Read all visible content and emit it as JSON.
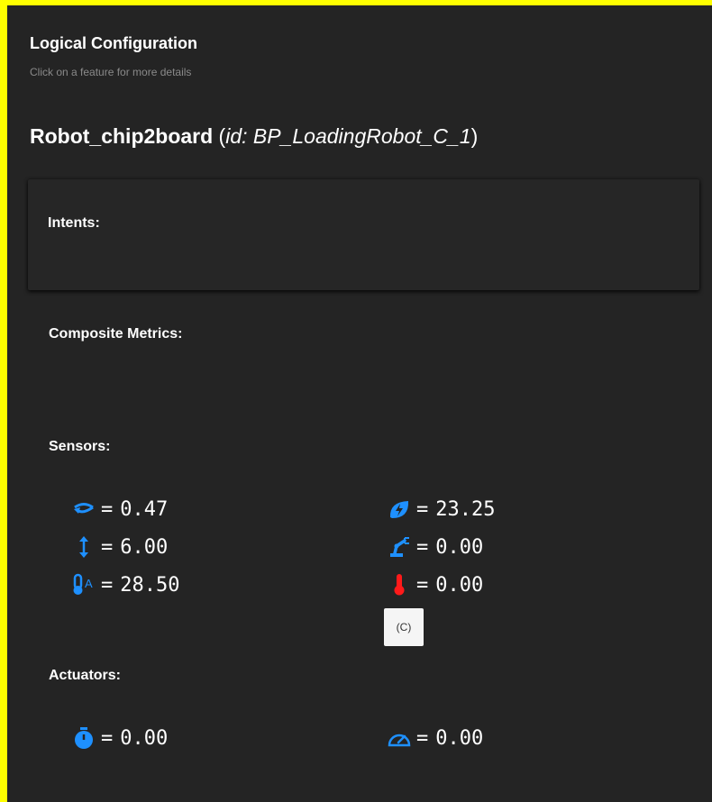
{
  "header": {
    "title": "Logical Configuration",
    "subtitle": "Click on a feature for more details"
  },
  "robot": {
    "name": "Robot_chip2board",
    "id_open": " (",
    "id_label": "id: BP_LoadingRobot_C_1",
    "id_close": ")"
  },
  "sections": {
    "intents": "Intents:",
    "composite_metrics": "Composite Metrics:",
    "sensors": "Sensors:",
    "actuators": "Actuators:"
  },
  "sensors": [
    {
      "icon": "rotation-icon",
      "eq": "=",
      "value": "0.47"
    },
    {
      "icon": "energy-leaf-icon",
      "eq": "=",
      "value": "23.25"
    },
    {
      "icon": "vertical-arrows-icon",
      "eq": "=",
      "value": "6.00"
    },
    {
      "icon": "robot-arm-icon",
      "eq": "=",
      "value": "0.00"
    },
    {
      "icon": "ambient-thermometer-icon",
      "eq": "=",
      "value": "28.50"
    },
    {
      "icon": "thermometer-icon",
      "eq": "=",
      "value": "0.00"
    }
  ],
  "tooltip": {
    "text": "(C)"
  },
  "actuators": [
    {
      "icon": "stopwatch-icon",
      "eq": "=",
      "value": "0.00"
    },
    {
      "icon": "speedometer-icon",
      "eq": "=",
      "value": "0.00"
    }
  ],
  "colors": {
    "background": "#242424",
    "border": "#ffff00",
    "icon_blue": "#1e90ff",
    "icon_red": "#ff1a1a",
    "subtitle": "#8a8a8a",
    "tooltip_bg": "#f5f5f5"
  }
}
